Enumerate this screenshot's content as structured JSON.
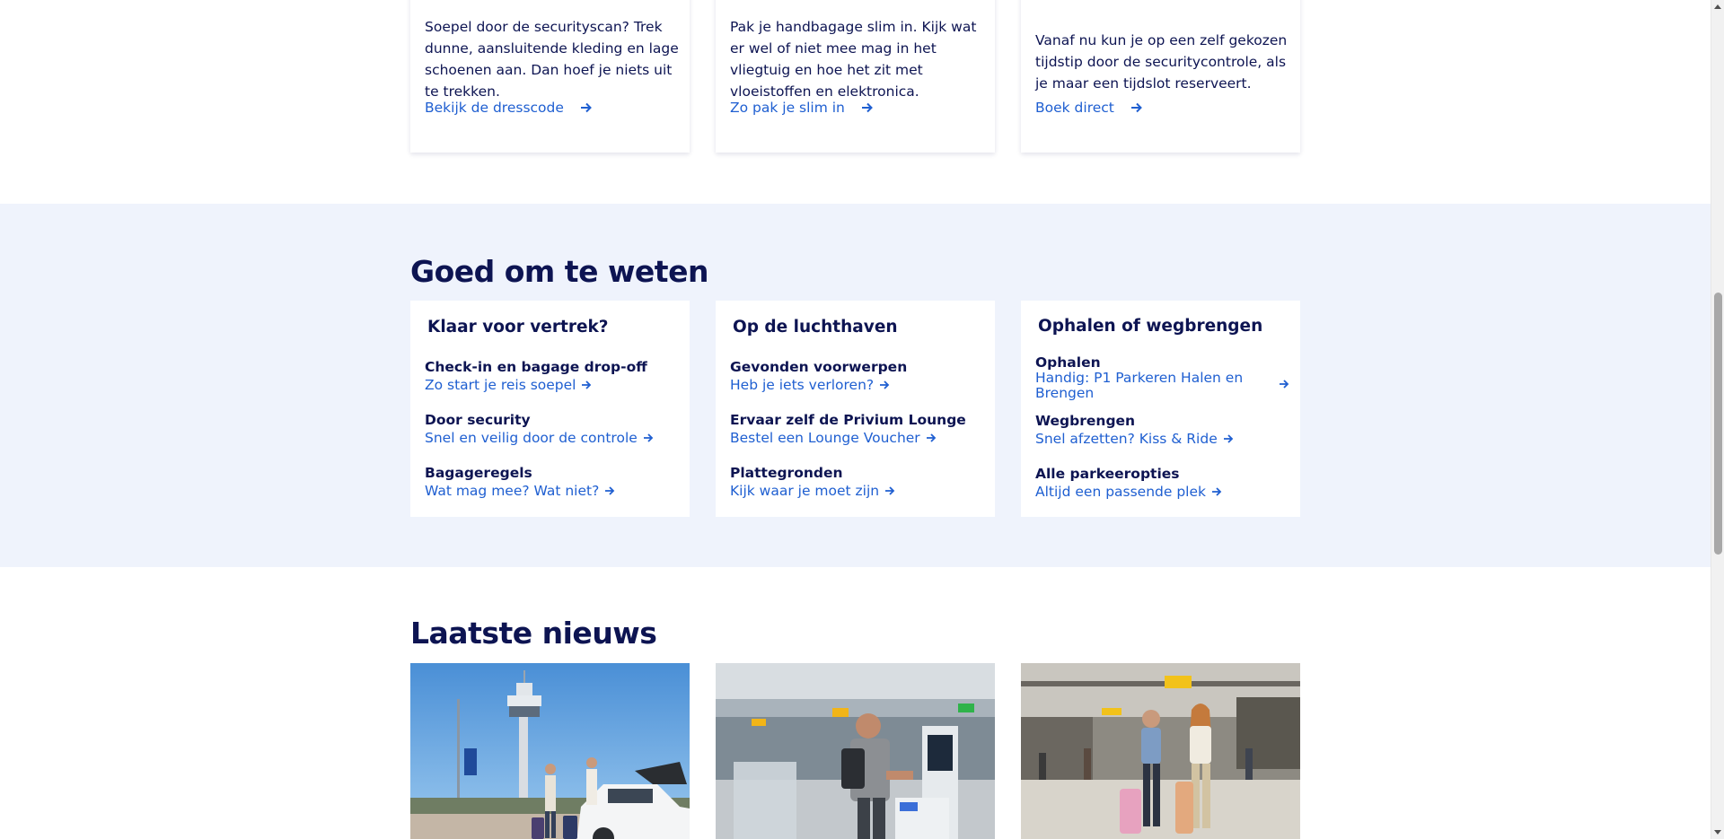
{
  "tips": [
    {
      "title": "",
      "text": "Soepel door de securityscan? Trek dunne, aansluitende kleding en lage schoenen aan. Dan hoef je niets uit te trekken.",
      "link": "Bekijk de dresscode",
      "link_icon": "arrow-right-icon"
    },
    {
      "title": "",
      "text": "Pak je handbagage slim in. Kijk wat er wel of niet mee mag in het vliegtuig en hoe het zit met vloeistoffen en elektronica.",
      "link": "Zo pak je slim in",
      "link_icon": "arrow-right-icon"
    },
    {
      "title": "",
      "text": "Vanaf nu kun je op een zelf gekozen tijdstip door de securitycontrole, als je maar een tijdslot reserveert.",
      "link": "Boek direct",
      "link_icon": "arrow-right-icon"
    }
  ],
  "good_to_know": {
    "heading": "Goed om te weten",
    "cards": [
      {
        "title": "Klaar voor vertrek?",
        "items": [
          {
            "heading": "Check-in en bagage drop-off",
            "link": "Zo start je reis soepel"
          },
          {
            "heading": "Door security",
            "link": "Snel en veilig door de controle"
          },
          {
            "heading": "Bagageregels",
            "link": "Wat mag mee? Wat niet?"
          }
        ]
      },
      {
        "title": "Op de luchthaven",
        "items": [
          {
            "heading": "Gevonden voorwerpen",
            "link": "Heb je iets verloren?"
          },
          {
            "heading": "Ervaar zelf de Privium Lounge",
            "link": "Bestel een Lounge Voucher"
          },
          {
            "heading": "Plattegronden",
            "link": "Kijk waar je moet zijn"
          }
        ]
      },
      {
        "title": "Ophalen of wegbrengen",
        "items": [
          {
            "heading": "Ophalen",
            "link": "Handig: P1 Parkeren Halen en Brengen"
          },
          {
            "heading": "Wegbrengen",
            "link": "Snel afzetten? Kiss & Ride"
          },
          {
            "heading": "Alle parkeeropties",
            "link": "Altijd een passende plek"
          }
        ]
      }
    ]
  },
  "news": {
    "heading": "Laatste nieuws",
    "items": [
      {
        "image": "photo-control-tower-drop-off"
      },
      {
        "image": "photo-security-gates-passenger"
      },
      {
        "image": "photo-terminal-travellers-suitcases"
      }
    ]
  },
  "colors": {
    "navy": "#0d1452",
    "link_blue": "#1f5fd1",
    "section_bg": "#eff3fc",
    "card_bg": "#ffffff"
  }
}
